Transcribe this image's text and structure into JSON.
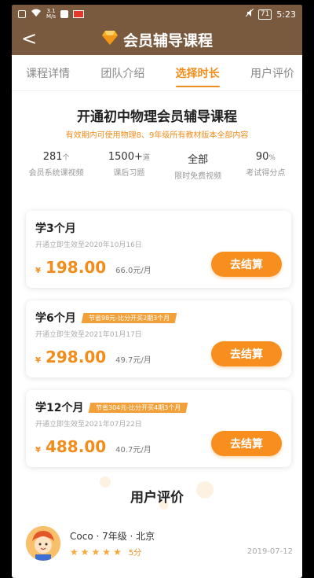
{
  "statusbar": {
    "speed_value": "3.1",
    "speed_unit": "M/s",
    "battery": "71",
    "time": "5:23"
  },
  "header": {
    "back_symbol": "<",
    "title": "会员辅导课程"
  },
  "tabs": [
    {
      "label": "课程详情",
      "active": false
    },
    {
      "label": "团队介绍",
      "active": false
    },
    {
      "label": "选择时长",
      "active": true
    },
    {
      "label": "用户评价",
      "active": false
    }
  ],
  "intro": {
    "title": "开通初中物理会员辅导课程",
    "subtitle": "有效期内可使用物理8、9年级所有教材版本全部内容"
  },
  "stats": [
    {
      "value": "281",
      "unit": "个",
      "label": "会员系统课视频"
    },
    {
      "value": "1500+",
      "unit": "道",
      "label": "课后习题"
    },
    {
      "value": "全部",
      "unit": "",
      "label": "限时免费视频"
    },
    {
      "value": "90",
      "unit": "%",
      "label": "考试得分点"
    }
  ],
  "plans": [
    {
      "name": "学3个月",
      "badge": "",
      "validity": "开通立即生效至2020年10月16日",
      "currency": "¥",
      "price": "198.00",
      "monthly": "66.0元/月",
      "button": "去结算"
    },
    {
      "name": "学6个月",
      "badge": "节省98元-比分开买2期3个月",
      "validity": "开通立即生效至2021年01月17日",
      "currency": "¥",
      "price": "298.00",
      "monthly": "49.7元/月",
      "button": "去结算"
    },
    {
      "name": "学12个月",
      "badge": "节省304元-比分开买4期3个月",
      "validity": "开通立即生效至2021年07月22日",
      "currency": "¥",
      "price": "488.00",
      "monthly": "40.7元/月",
      "button": "去结算"
    }
  ],
  "reviews": {
    "title": "用户评价",
    "items": [
      {
        "user": "Coco · 7年级 · 北京",
        "rating": 5,
        "score": "5分",
        "date": "2019-07-12"
      }
    ]
  },
  "colors": {
    "brand": "#7a5a3e",
    "accent": "#f28d1c"
  }
}
